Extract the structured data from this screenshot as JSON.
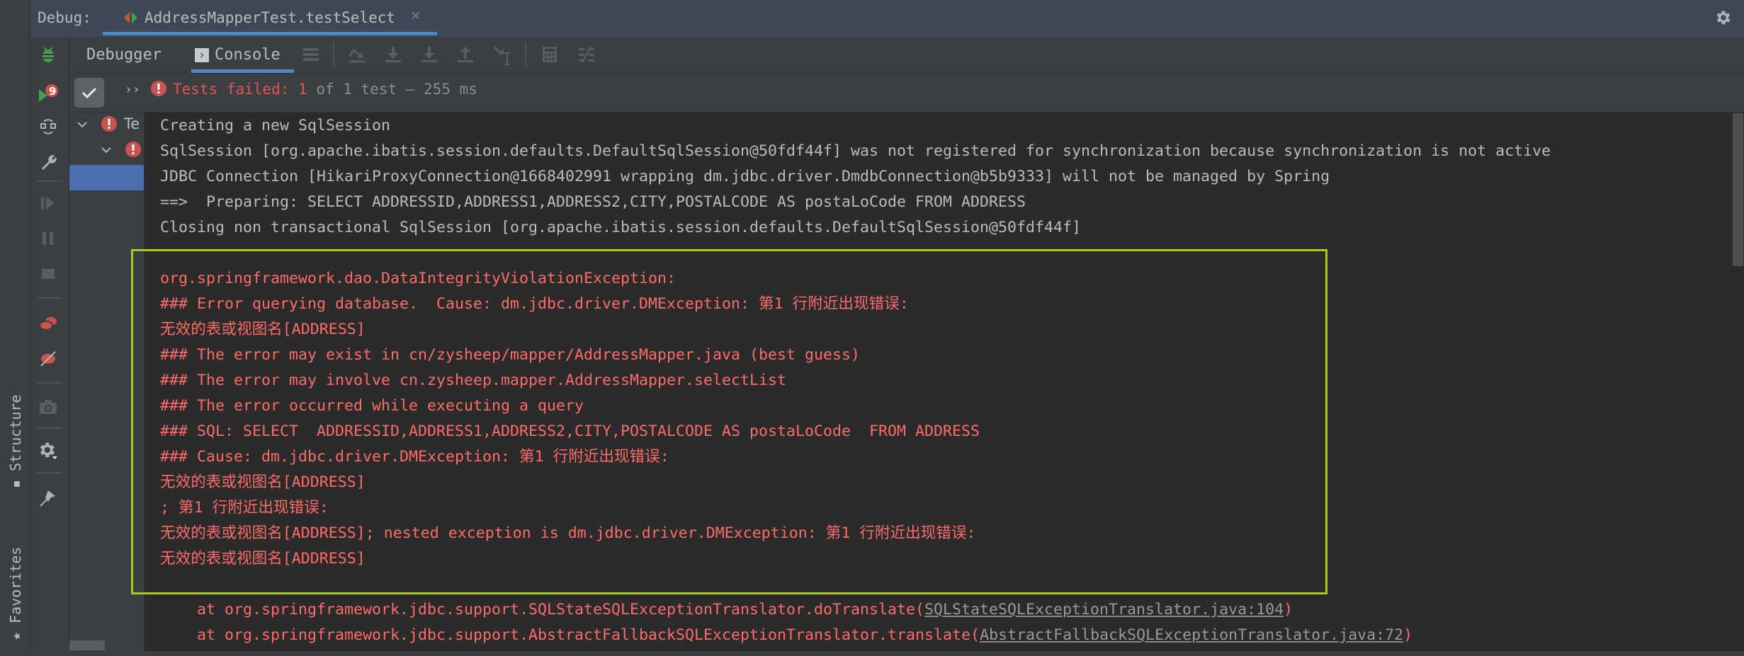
{
  "header": {
    "label": "Debug:",
    "tab_title": "AddressMapperTest.testSelect",
    "close_glyph": "×",
    "settings_icon": "gear-icon"
  },
  "left_strip": {
    "structure_label": "Structure",
    "favorites_label": "Favorites"
  },
  "side_toolbar": {
    "icons": [
      "debug-bug-icon",
      "rerun-failed-icon",
      "restore-layout-icon",
      "wrench-icon",
      "resume-icon",
      "pause-icon",
      "stop-icon",
      "view-breakpoints-icon",
      "mute-breakpoints-icon",
      "camera-icon",
      "settings-icon",
      "pin-icon"
    ]
  },
  "tabs": {
    "debugger": "Debugger",
    "console": "Console",
    "console_icon": "›"
  },
  "toolbar": {
    "icons": [
      "menu-icon",
      "step-over-icon",
      "step-into-icon",
      "force-step-into-icon",
      "step-out-icon",
      "run-to-cursor-icon",
      "evaluate-icon",
      "trace-icon"
    ]
  },
  "status": {
    "chevrons": "››",
    "prefix": "Tests failed: ",
    "failed_count": "1",
    "suffix": " of 1 test – 255 ms"
  },
  "tree": {
    "root_label": "Te"
  },
  "console": {
    "info_lines": [
      "Creating a new SqlSession",
      "SqlSession [org.apache.ibatis.session.defaults.DefaultSqlSession@50fdf44f] was not registered for synchronization because synchronization is not active",
      "JDBC Connection [HikariProxyConnection@1668402991 wrapping dm.jdbc.driver.DmdbConnection@b5b9333] will not be managed by Spring",
      "==>  Preparing: SELECT ADDRESSID,ADDRESS1,ADDRESS2,CITY,POSTALCODE AS postaLoCode FROM ADDRESS",
      "Closing non transactional SqlSession [org.apache.ibatis.session.defaults.DefaultSqlSession@50fdf44f]"
    ],
    "error_lines": [
      "org.springframework.dao.DataIntegrityViolationException:",
      "### Error querying database.  Cause: dm.jdbc.driver.DMException: 第1 行附近出现错误:",
      "无效的表或视图名[ADDRESS]",
      "### The error may exist in cn/zysheep/mapper/AddressMapper.java (best guess)",
      "### The error may involve cn.zysheep.mapper.AddressMapper.selectList",
      "### The error occurred while executing a query",
      "### SQL: SELECT  ADDRESSID,ADDRESS1,ADDRESS2,CITY,POSTALCODE AS postaLoCode  FROM ADDRESS",
      "### Cause: dm.jdbc.driver.DMException: 第1 行附近出现错误:",
      "无效的表或视图名[ADDRESS]",
      "; 第1 行附近出现错误:",
      "无效的表或视图名[ADDRESS]; nested exception is dm.jdbc.driver.DMException: 第1 行附近出现错误:",
      "无效的表或视图名[ADDRESS]"
    ],
    "stack_lines": [
      {
        "prefix": "    at org.springframework.jdbc.support.SQLStateSQLExceptionTranslator.doTranslate(",
        "link": "SQLStateSQLExceptionTranslator.java:104",
        "suffix": ")"
      },
      {
        "prefix": "    at org.springframework.jdbc.support.AbstractFallbackSQLExceptionTranslator.translate(",
        "link": "AbstractFallbackSQLExceptionTranslator.java:72",
        "suffix": ")"
      }
    ]
  },
  "colors": {
    "error_text": "#ff6b68",
    "normal_text": "#bbbbbb",
    "highlight_box": "#a5c91c",
    "accent_blue": "#4a88c7"
  }
}
